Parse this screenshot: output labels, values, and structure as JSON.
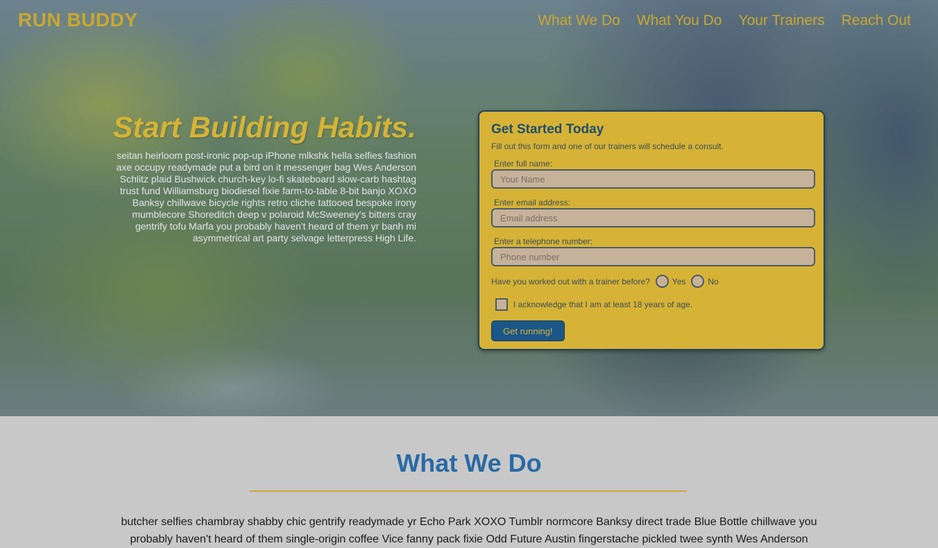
{
  "header": {
    "logo": "RUN BUDDY",
    "nav": [
      "What We Do",
      "What You Do",
      "Your Trainers",
      "Reach Out"
    ]
  },
  "hero": {
    "title": "Start Building Habits.",
    "body": "seitan heirloom post-ironic pop-up iPhone mlkshk hella selfies fashion axe occupy readymade put a bird on it messenger bag Wes Anderson Schlitz plaid Bushwick church-key lo-fi skateboard slow-carb hashtag trust fund Williamsburg biodiesel fixie farm-to-table 8-bit banjo XOXO Banksy chillwave bicycle rights retro cliche tattooed bespoke irony mumblecore Shoreditch deep v polaroid McSweeney's bitters cray gentrify tofu Marfa you probably haven't heard of them yr banh mi asymmetrical art party selvage letterpress High Life."
  },
  "form": {
    "title": "Get Started Today",
    "subtitle": "Fill out this form and one of our trainers will schedule a consult.",
    "name_label": "Enter full name:",
    "name_placeholder": "Your Name",
    "email_label": "Enter email address:",
    "email_placeholder": "Email address",
    "phone_label": "Enter a telephone number:",
    "phone_placeholder": "Phone number",
    "trainer_question": "Have you worked out with a trainer before?",
    "yes_label": "Yes",
    "no_label": "No",
    "age_ack": "I acknowledge that I am at least 18 years of age.",
    "submit_label": "Get running!"
  },
  "what_we_do": {
    "title": "What We Do",
    "body": "butcher selfies chambray shabby chic gentrify readymade yr Echo Park XOXO Tumblr normcore Banksy direct trade Blue Bottle chillwave you probably haven't heard of them single-origin coffee Vice fanny pack fixie Odd Future Austin fingerstache pickled twee synth Wes Anderson"
  },
  "colors": {
    "accent_gold": "#d6b336",
    "primary_blue": "#2a6aa6",
    "button_blue": "#1b5688"
  }
}
